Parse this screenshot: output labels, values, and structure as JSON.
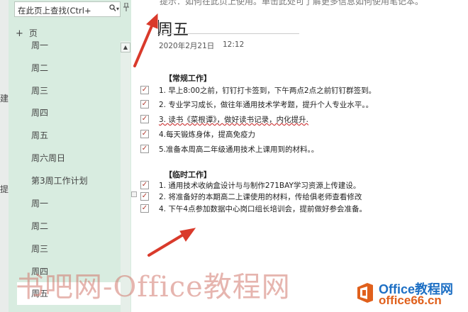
{
  "edge": {
    "chars": [
      "建",
      "提"
    ]
  },
  "search": {
    "placeholder": "在此页上查找(Ctrl+",
    "icon": "search-icon",
    "dropdown_icon": "chevron-down-icon"
  },
  "panel": {
    "add_page_label": "页",
    "pages": [
      {
        "label": "周一",
        "selected": false
      },
      {
        "label": "周二",
        "selected": false
      },
      {
        "label": "周三",
        "selected": false
      },
      {
        "label": "周四",
        "selected": false
      },
      {
        "label": "周五",
        "selected": false
      },
      {
        "label": "周六周日",
        "selected": false
      },
      {
        "label": "第3周工作计划",
        "selected": false
      },
      {
        "label": "周一",
        "selected": false
      },
      {
        "label": "周二",
        "selected": false
      },
      {
        "label": "周三",
        "selected": false
      },
      {
        "label": "周四",
        "selected": false
      },
      {
        "label": "周五",
        "selected": true
      }
    ]
  },
  "topbar": {
    "text": "提示：如何在此页上使用。单击此处可了解更多信息如何使用笔记本。"
  },
  "note": {
    "title": "周五",
    "date": "2020年2月21日",
    "time": "12:12",
    "routine": {
      "heading": "【常规工作】",
      "tasks": [
        {
          "text": "1. 早上8:00之前，钉钉打卡签到，下午两点2点之前钉钉群签到。",
          "checked": true
        },
        {
          "text": "2. 专业学习成长，做往年通用技术学考题，提升个人专业水平。。",
          "checked": true
        },
        {
          "text": "3. 读书《菜根谭》，做好读书记录，内化提升.",
          "checked": true
        },
        {
          "text": "4.每天锻炼身体，提高免疫力",
          "checked": true
        },
        {
          "text": "5.准备本周高二年级通用技术上课用到的材料。。",
          "checked": true
        }
      ]
    },
    "temporary": {
      "heading": "【临时工作】",
      "tasks": [
        {
          "text": "1. 通用技术收纳盒设计与与制作271BAY学习资源上传建设。",
          "checked": true
        },
        {
          "text": "2. 将准备好的本期高二上课使用的材料，传给俱老师查看修改",
          "checked": true
        },
        {
          "text": "4. 下午4点参加数据中心岗口组长培训会，提前做好参会准备。",
          "checked": true
        }
      ]
    }
  },
  "watermark": {
    "text": "书吧网-Office教程网",
    "brand_line1": "Office教程网",
    "brand_line2": "office66.cn"
  },
  "colors": {
    "panel_bg": "#d8ece0",
    "arrow": "#d93a2b",
    "brand_blue": "#1d6fc4",
    "brand_orange": "#e0601c"
  }
}
